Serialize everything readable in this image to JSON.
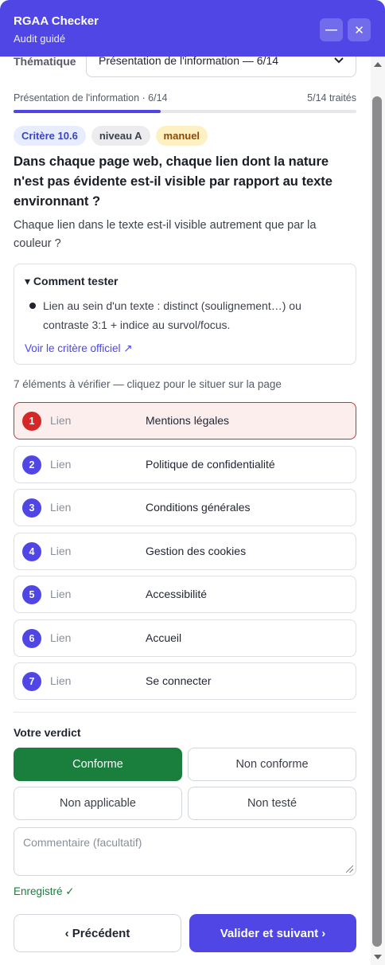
{
  "header": {
    "title": "RGAA Checker",
    "subtitle": "Audit guidé",
    "minimize_icon": "minimize-icon",
    "close_icon": "close-icon",
    "minimize_glyph": "—",
    "close_glyph": "✕"
  },
  "thematique": {
    "label": "Thématique",
    "selected": "Présentation de l'information — 6/14"
  },
  "progress": {
    "left_text": "Présentation de l'information · 6/14",
    "right_text": "5/14 traités",
    "fraction": 0.43
  },
  "badges": {
    "critere": "Critère 10.6",
    "niveau": "niveau A",
    "mode": "manuel"
  },
  "question": "Dans chaque page web, chaque lien dont la nature n'est pas évidente est-il visible par rapport au texte environnant ?",
  "subquestion": "Chaque lien dans le texte est-il visible autrement que par la couleur ?",
  "howto": {
    "title": "▾ Comment tester",
    "bullet": "Lien au sein d'un texte : distinct (soulignement…) ou contraste 3:1 + indice au survol/focus.",
    "link": "Voir le critère officiel ↗"
  },
  "elements": {
    "count_label": "7 éléments à vérifier — cliquez pour le situer sur la page",
    "items": [
      {
        "num": "1",
        "type": "Lien",
        "label": "Mentions légales",
        "active": true
      },
      {
        "num": "2",
        "type": "Lien",
        "label": "Politique de confidentialité",
        "active": false
      },
      {
        "num": "3",
        "type": "Lien",
        "label": "Conditions générales",
        "active": false
      },
      {
        "num": "4",
        "type": "Lien",
        "label": "Gestion des cookies",
        "active": false
      },
      {
        "num": "5",
        "type": "Lien",
        "label": "Accessibilité",
        "active": false
      },
      {
        "num": "6",
        "type": "Lien",
        "label": "Accueil",
        "active": false
      },
      {
        "num": "7",
        "type": "Lien",
        "label": "Se connecter",
        "active": false
      }
    ]
  },
  "verdict": {
    "label": "Votre verdict",
    "conforme": "Conforme",
    "non_conforme": "Non conforme",
    "non_applicable": "Non applicable",
    "non_teste": "Non testé",
    "selected": "Conforme",
    "comment_placeholder": "Commentaire (facultatif)",
    "saved": "Enregistré ✓"
  },
  "nav": {
    "previous": "‹ Précédent",
    "next": "Valider et suivant ›"
  },
  "colors": {
    "accent": "#4f46e5",
    "success": "#1a7f3c",
    "danger": "#d62728"
  }
}
